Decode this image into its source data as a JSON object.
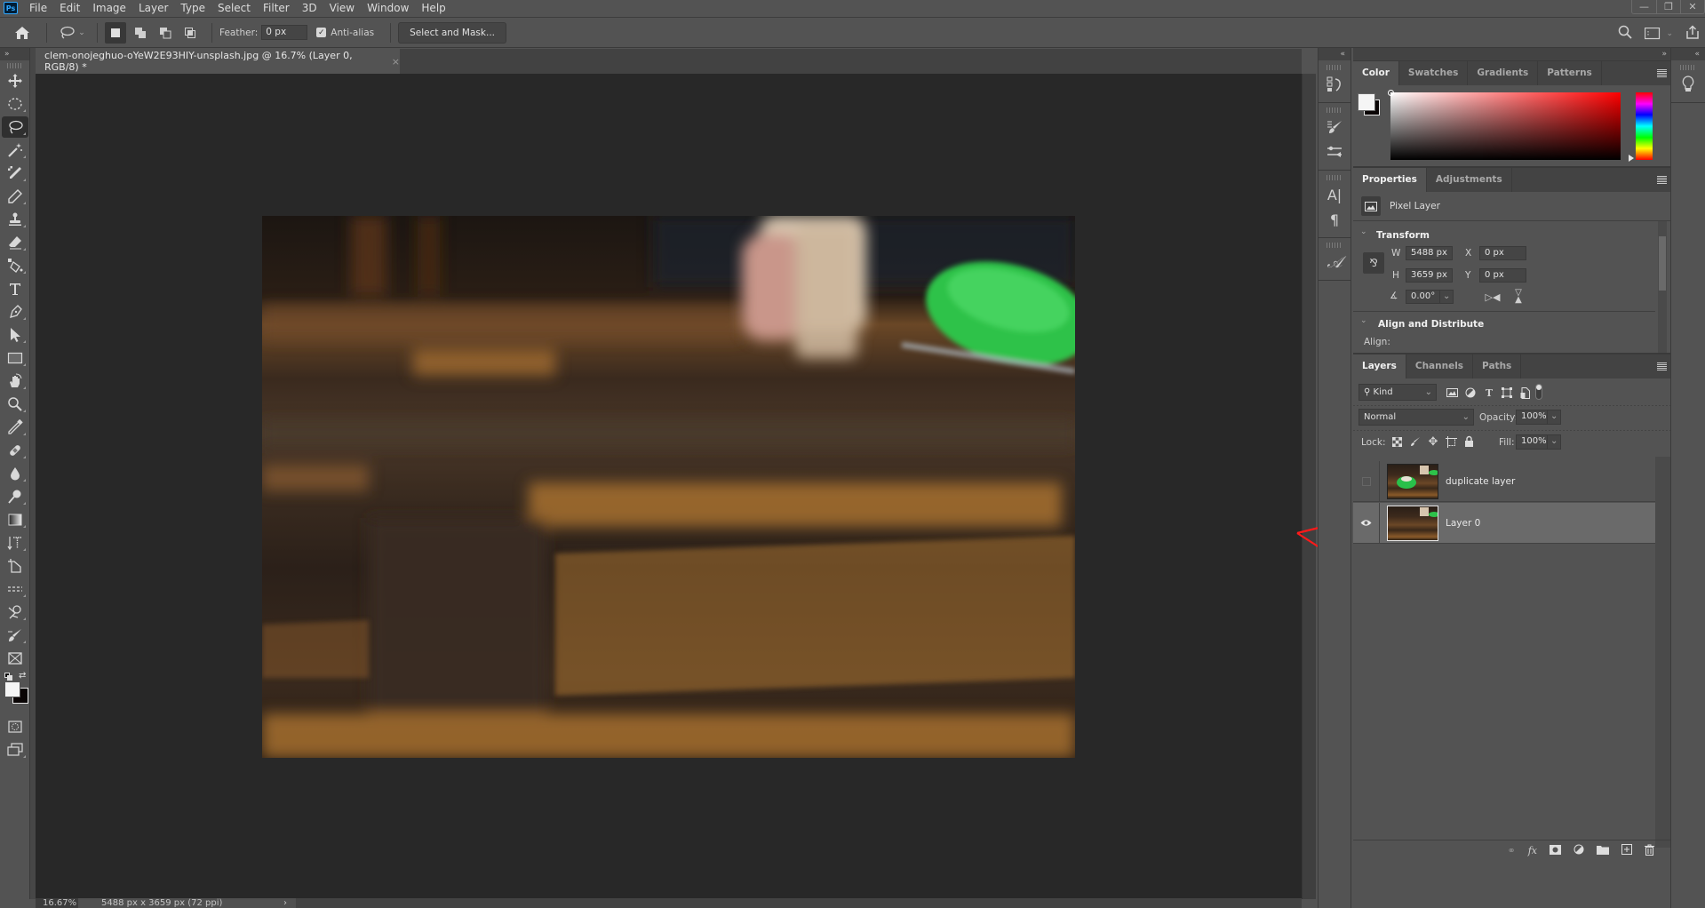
{
  "app": {
    "logo": "Ps",
    "menu": [
      "File",
      "Edit",
      "Image",
      "Layer",
      "Type",
      "Select",
      "Filter",
      "3D",
      "View",
      "Window",
      "Help"
    ],
    "window_controls": [
      "minimize",
      "restore",
      "close"
    ]
  },
  "options_bar": {
    "active_tool": "lasso-tool",
    "feather_label": "Feather:",
    "feather_value": "0 px",
    "antialias_label": "Anti-alias",
    "antialias_checked": true,
    "select_and_mask_label": "Select and Mask...",
    "right_icons": [
      "search-icon",
      "workspace-icon",
      "share-icon"
    ]
  },
  "document": {
    "tab_title": "clem-onojeghuo-oYeW2E93HIY-unsplash.jpg @ 16.7% (Layer 0, RGB/8) *",
    "close_glyph": "×",
    "accent_colors": {
      "table_orange": "#c9842e",
      "plate_green": "#2ec24a",
      "dark_wood": "#2a2019"
    }
  },
  "status_bar": {
    "zoom": "16.67%",
    "doc_info": "5488 px x 3659 px (72 ppi)",
    "arrow": "›"
  },
  "toolbar": {
    "tools": [
      "move-tool",
      "elliptical-marquee-tool",
      "lasso-tool",
      "magic-wand-tool",
      "color-sampler-tool",
      "pencil-tool",
      "clone-stamp-tool",
      "eraser-tool",
      "paint-bucket-tool",
      "type-tool",
      "pen-tool",
      "path-selection-tool",
      "rectangle-tool",
      "hand-rotate-tool",
      "zoom-tool",
      "eyedropper-tool",
      "healing-brush-tool",
      "blur-tool",
      "dodge-tool",
      "gradient-tool",
      "vertical-type-mask-tool",
      "crop-tool",
      "dashed-line-tool",
      "puppet-warp-tool",
      "mixer-brush-tool",
      "frame-tool"
    ],
    "foreground_color": "#f5f5f5",
    "background_color": "#0a0505"
  },
  "color_panel": {
    "tabs": [
      "Color",
      "Swatches",
      "Gradients",
      "Patterns"
    ],
    "active_tab": "Color",
    "hue": "#ff0000"
  },
  "properties_panel": {
    "tabs": [
      "Properties",
      "Adjustments"
    ],
    "active_tab": "Properties",
    "layer_type": "Pixel Layer",
    "transform_title": "Transform",
    "w_label": "W",
    "w_value": "5488 px",
    "h_label": "H",
    "h_value": "3659 px",
    "x_label": "X",
    "x_value": "0 px",
    "y_label": "Y",
    "y_value": "0 px",
    "angle_value": "0.00°",
    "align_title": "Align and Distribute",
    "align_label": "Align:"
  },
  "layers_panel": {
    "tabs": [
      "Layers",
      "Channels",
      "Paths"
    ],
    "active_tab": "Layers",
    "filter_kind": "Kind",
    "blend_mode": "Normal",
    "opacity_label": "Opacity:",
    "opacity_value": "100%",
    "lock_label": "Lock:",
    "fill_label": "Fill:",
    "fill_value": "100%",
    "layers": [
      {
        "name": "duplicate layer",
        "visible": false,
        "selected": false
      },
      {
        "name": "Layer 0",
        "visible": true,
        "selected": true
      }
    ],
    "annotation_arrow_color": "#ff1a1a"
  }
}
